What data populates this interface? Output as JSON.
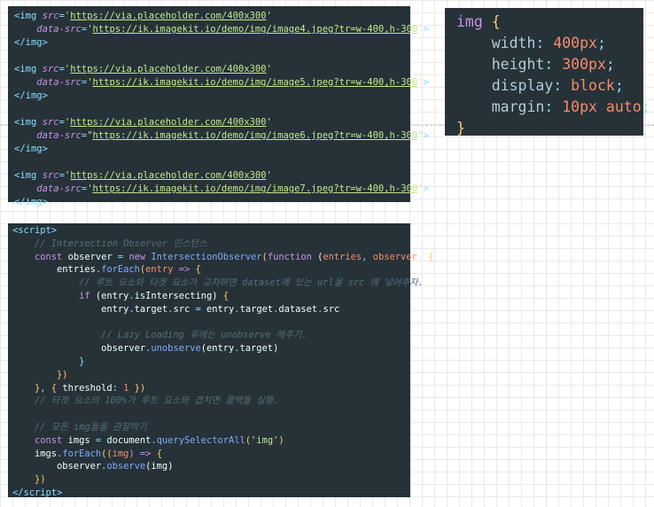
{
  "html_code": {
    "lines": [
      [
        {
          "t": "<",
          "c": "punct"
        },
        {
          "t": "img",
          "c": "tag"
        },
        {
          "t": " src",
          "c": "attr"
        },
        {
          "t": "=",
          "c": "punct"
        },
        {
          "t": "'",
          "c": "str"
        },
        {
          "t": "https://via.placeholder.com/400x300",
          "c": "url"
        },
        {
          "t": "'",
          "c": "str"
        }
      ],
      [
        {
          "t": "    data-src",
          "c": "attr"
        },
        {
          "t": "=",
          "c": "punct"
        },
        {
          "t": "'",
          "c": "str"
        },
        {
          "t": "https://ik.imagekit.io/demo/img/image4.jpeg?tr=w-400,h-300",
          "c": "url"
        },
        {
          "t": "'",
          "c": "str"
        },
        {
          "t": ">",
          "c": "punct"
        }
      ],
      [
        {
          "t": "</",
          "c": "punct"
        },
        {
          "t": "img",
          "c": "tag"
        },
        {
          "t": ">",
          "c": "punct"
        }
      ],
      [],
      [
        {
          "t": "<",
          "c": "punct"
        },
        {
          "t": "img",
          "c": "tag"
        },
        {
          "t": " src",
          "c": "attr"
        },
        {
          "t": "=",
          "c": "punct"
        },
        {
          "t": "'",
          "c": "str"
        },
        {
          "t": "https://via.placeholder.com/400x300",
          "c": "url"
        },
        {
          "t": "'",
          "c": "str"
        }
      ],
      [
        {
          "t": "    data-src",
          "c": "attr"
        },
        {
          "t": "=",
          "c": "punct"
        },
        {
          "t": "'",
          "c": "str"
        },
        {
          "t": "https://ik.imagekit.io/demo/img/image5.jpeg?tr=w-400,h-300",
          "c": "url"
        },
        {
          "t": "'",
          "c": "str"
        },
        {
          "t": ">",
          "c": "punct"
        }
      ],
      [
        {
          "t": "</",
          "c": "punct"
        },
        {
          "t": "img",
          "c": "tag"
        },
        {
          "t": ">",
          "c": "punct"
        }
      ],
      [],
      [
        {
          "t": "<",
          "c": "punct"
        },
        {
          "t": "img",
          "c": "tag"
        },
        {
          "t": " src",
          "c": "attr"
        },
        {
          "t": "=",
          "c": "punct"
        },
        {
          "t": "'",
          "c": "str"
        },
        {
          "t": "https://via.placeholder.com/400x300",
          "c": "url"
        },
        {
          "t": "'",
          "c": "str"
        }
      ],
      [
        {
          "t": "    data-src",
          "c": "attr"
        },
        {
          "t": "=",
          "c": "punct"
        },
        {
          "t": "\"",
          "c": "str"
        },
        {
          "t": "https://ik.imagekit.io/demo/img/image6.jpeg?tr=w-400,h-300",
          "c": "url"
        },
        {
          "t": "\"",
          "c": "str"
        },
        {
          "t": ">",
          "c": "punct"
        }
      ],
      [
        {
          "t": "</",
          "c": "punct"
        },
        {
          "t": "img",
          "c": "tag"
        },
        {
          "t": ">",
          "c": "punct"
        }
      ],
      [],
      [
        {
          "t": "<",
          "c": "punct"
        },
        {
          "t": "img",
          "c": "tag"
        },
        {
          "t": " src",
          "c": "attr"
        },
        {
          "t": "=",
          "c": "punct"
        },
        {
          "t": "'",
          "c": "str"
        },
        {
          "t": "https://via.placeholder.com/400x300",
          "c": "url"
        },
        {
          "t": "'",
          "c": "str"
        }
      ],
      [
        {
          "t": "    data-src",
          "c": "attr"
        },
        {
          "t": "=",
          "c": "punct"
        },
        {
          "t": "'",
          "c": "str"
        },
        {
          "t": "https://ik.imagekit.io/demo/img/image7.jpeg?tr=w-400,h-300",
          "c": "url"
        },
        {
          "t": "'",
          "c": "str"
        },
        {
          "t": ">",
          "c": "punct"
        }
      ],
      [
        {
          "t": "</",
          "c": "punct"
        },
        {
          "t": "img",
          "c": "tag"
        },
        {
          "t": ">",
          "c": "punct"
        }
      ]
    ]
  },
  "css_code": {
    "lines": [
      [
        {
          "t": "img",
          "c": "sel"
        },
        {
          "t": " ",
          "c": "plain"
        },
        {
          "t": "{",
          "c": "brace"
        }
      ],
      [
        {
          "t": "    width",
          "c": "prop"
        },
        {
          "t": ": ",
          "c": "punct"
        },
        {
          "t": "400px",
          "c": "num"
        },
        {
          "t": ";",
          "c": "punct"
        }
      ],
      [
        {
          "t": "    height",
          "c": "prop"
        },
        {
          "t": ": ",
          "c": "punct"
        },
        {
          "t": "300px",
          "c": "num"
        },
        {
          "t": ";",
          "c": "punct"
        }
      ],
      [
        {
          "t": "    display",
          "c": "prop"
        },
        {
          "t": ": ",
          "c": "punct"
        },
        {
          "t": "block",
          "c": "num"
        },
        {
          "t": ";",
          "c": "punct"
        }
      ],
      [
        {
          "t": "    margin",
          "c": "prop"
        },
        {
          "t": ": ",
          "c": "punct"
        },
        {
          "t": "10px auto",
          "c": "num"
        },
        {
          "t": ";",
          "c": "punct"
        }
      ],
      [
        {
          "t": "}",
          "c": "brace"
        }
      ]
    ]
  },
  "js_code": {
    "lines": [
      [
        {
          "t": "<",
          "c": "punct"
        },
        {
          "t": "script",
          "c": "tag"
        },
        {
          "t": ">",
          "c": "punct"
        }
      ],
      [
        {
          "t": "    // Intersection Observer 인스턴스",
          "c": "comment"
        }
      ],
      [
        {
          "t": "    const ",
          "c": "kw"
        },
        {
          "t": "observer",
          "c": "plain"
        },
        {
          "t": " = ",
          "c": "punct"
        },
        {
          "t": "new ",
          "c": "kw"
        },
        {
          "t": "IntersectionObserver",
          "c": "fn"
        },
        {
          "t": "(",
          "c": "brace"
        },
        {
          "t": "function",
          "c": "kw"
        },
        {
          "t": " (",
          "c": "plain"
        },
        {
          "t": "entries",
          "c": "param"
        },
        {
          "t": ", ",
          "c": "punct"
        },
        {
          "t": "observer",
          "c": "param"
        },
        {
          "t": ") ",
          "c": "plain"
        },
        {
          "t": "{",
          "c": "brace"
        }
      ],
      [
        {
          "t": "        entries",
          "c": "plain"
        },
        {
          "t": ".",
          "c": "punct"
        },
        {
          "t": "forEach",
          "c": "fn"
        },
        {
          "t": "(",
          "c": "brace"
        },
        {
          "t": "entry",
          "c": "param"
        },
        {
          "t": " => ",
          "c": "kw"
        },
        {
          "t": "{",
          "c": "brace"
        }
      ],
      [
        {
          "t": "            // 루트 요소와 타겟 요소가 교차하면 dataset에 있는 url을 src 에 넣어주자.",
          "c": "comment"
        }
      ],
      [
        {
          "t": "            if ",
          "c": "kw"
        },
        {
          "t": "(",
          "c": "plain"
        },
        {
          "t": "entry",
          "c": "plain"
        },
        {
          "t": ".",
          "c": "punct"
        },
        {
          "t": "isIntersecting",
          "c": "plain"
        },
        {
          "t": ") ",
          "c": "plain"
        },
        {
          "t": "{",
          "c": "brace"
        }
      ],
      [
        {
          "t": "                entry",
          "c": "plain"
        },
        {
          "t": ".",
          "c": "punct"
        },
        {
          "t": "target",
          "c": "plain"
        },
        {
          "t": ".",
          "c": "punct"
        },
        {
          "t": "src",
          "c": "plain"
        },
        {
          "t": " = ",
          "c": "punct"
        },
        {
          "t": "entry",
          "c": "plain"
        },
        {
          "t": ".",
          "c": "punct"
        },
        {
          "t": "target",
          "c": "plain"
        },
        {
          "t": ".",
          "c": "punct"
        },
        {
          "t": "dataset",
          "c": "plain"
        },
        {
          "t": ".",
          "c": "punct"
        },
        {
          "t": "src",
          "c": "plain"
        }
      ],
      [],
      [
        {
          "t": "                // Lazy Loading 후에는 unobserve 해주기.",
          "c": "comment"
        }
      ],
      [
        {
          "t": "                observer",
          "c": "plain"
        },
        {
          "t": ".",
          "c": "punct"
        },
        {
          "t": "unobserve",
          "c": "fn"
        },
        {
          "t": "(",
          "c": "plain"
        },
        {
          "t": "entry",
          "c": "plain"
        },
        {
          "t": ".",
          "c": "punct"
        },
        {
          "t": "target",
          "c": "plain"
        },
        {
          "t": ")",
          "c": "plain"
        }
      ],
      [
        {
          "t": "            }",
          "c": "tag"
        }
      ],
      [
        {
          "t": "        })",
          "c": "brace"
        }
      ],
      [
        {
          "t": "    }",
          "c": "brace"
        },
        {
          "t": ", ",
          "c": "punct"
        },
        {
          "t": "{ ",
          "c": "brace"
        },
        {
          "t": "threshold",
          "c": "plain"
        },
        {
          "t": ": ",
          "c": "punct"
        },
        {
          "t": "1",
          "c": "num"
        },
        {
          "t": " })",
          "c": "brace"
        }
      ],
      [
        {
          "t": "    // 타겟 요소의 100%가 루트 요소와 겹치면 콜백을 실행.",
          "c": "comment"
        }
      ],
      [],
      [
        {
          "t": "    // 모든 img들을 관찰하기",
          "c": "comment"
        }
      ],
      [
        {
          "t": "    const ",
          "c": "kw"
        },
        {
          "t": "imgs",
          "c": "plain"
        },
        {
          "t": " = ",
          "c": "punct"
        },
        {
          "t": "document",
          "c": "plain"
        },
        {
          "t": ".",
          "c": "punct"
        },
        {
          "t": "querySelectorAll",
          "c": "fn"
        },
        {
          "t": "(",
          "c": "brace"
        },
        {
          "t": "'img'",
          "c": "str"
        },
        {
          "t": ")",
          "c": "brace"
        }
      ],
      [
        {
          "t": "    imgs",
          "c": "plain"
        },
        {
          "t": ".",
          "c": "punct"
        },
        {
          "t": "forEach",
          "c": "fn"
        },
        {
          "t": "((",
          "c": "brace"
        },
        {
          "t": "img",
          "c": "param"
        },
        {
          "t": ") => ",
          "c": "kw"
        },
        {
          "t": "{",
          "c": "brace"
        }
      ],
      [
        {
          "t": "        observer",
          "c": "plain"
        },
        {
          "t": ".",
          "c": "punct"
        },
        {
          "t": "observe",
          "c": "fn"
        },
        {
          "t": "(",
          "c": "plain"
        },
        {
          "t": "img",
          "c": "plain"
        },
        {
          "t": ")",
          "c": "plain"
        }
      ],
      [
        {
          "t": "    })",
          "c": "brace"
        }
      ],
      [
        {
          "t": "</",
          "c": "punct"
        },
        {
          "t": "script",
          "c": "tag"
        },
        {
          "t": ">",
          "c": "punct"
        }
      ]
    ]
  }
}
